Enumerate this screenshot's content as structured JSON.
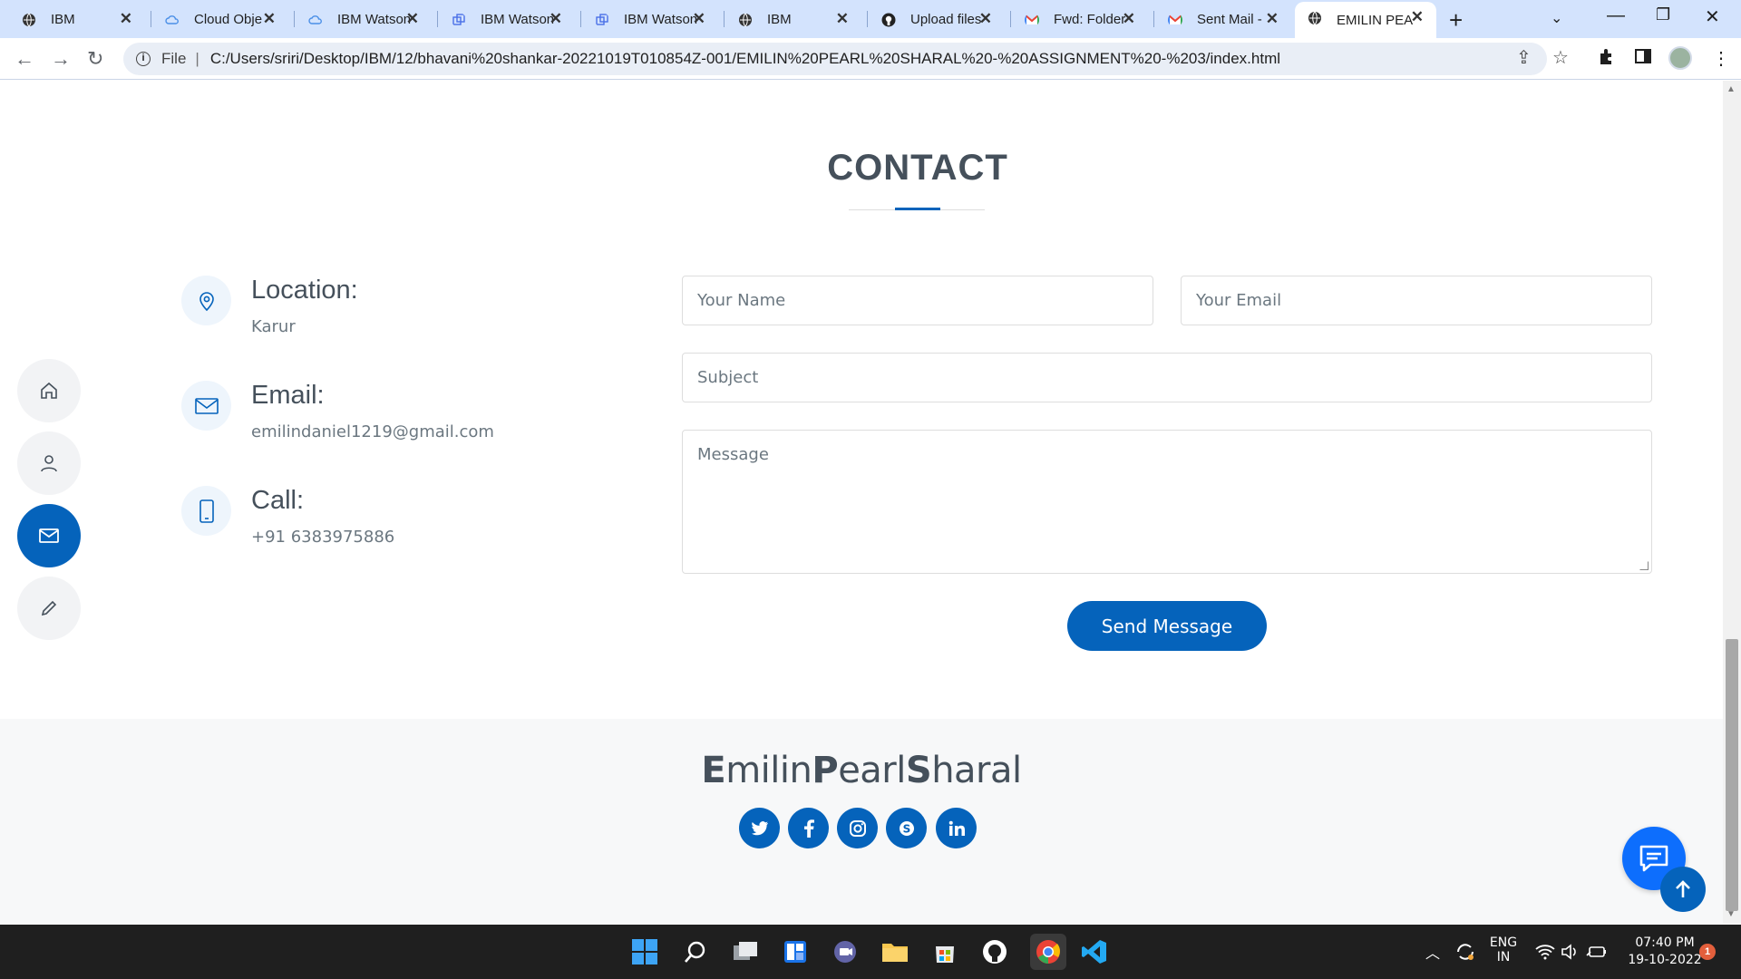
{
  "browser": {
    "tabs": [
      {
        "title": "IBM",
        "favicon": "globe-icon"
      },
      {
        "title": "Cloud Obje",
        "favicon": "cloud-icon"
      },
      {
        "title": "IBM Watson",
        "favicon": "cloud-icon"
      },
      {
        "title": "IBM Watson",
        "favicon": "watson-icon"
      },
      {
        "title": "IBM Watson",
        "favicon": "watson-icon"
      },
      {
        "title": "IBM",
        "favicon": "globe-icon"
      },
      {
        "title": "Upload files",
        "favicon": "github-icon"
      },
      {
        "title": "Fwd: Folder",
        "favicon": "gmail-icon"
      },
      {
        "title": "Sent Mail -",
        "favicon": "gmail-icon"
      },
      {
        "title": "EMILIN PEA",
        "favicon": "globe-icon",
        "active": true
      }
    ],
    "address": {
      "scheme_label": "File",
      "url": "C:/Users/sriri/Desktop/IBM/12/bhavani%20shankar-20221019T010854Z-001/EMILIN%20PEARL%20SHARAL%20-%20ASSIGNMENT%20-%203/index.html"
    }
  },
  "contact": {
    "title": "CONTACT",
    "location": {
      "label": "Location:",
      "value": "Karur"
    },
    "email": {
      "label": "Email:",
      "value": "emilindaniel1219@gmail.com"
    },
    "call": {
      "label": "Call:",
      "value": "+91 6383975886"
    },
    "form": {
      "name_placeholder": "Your Name",
      "email_placeholder": "Your Email",
      "subject_placeholder": "Subject",
      "message_placeholder": "Message",
      "send_label": "Send Message"
    }
  },
  "sidenav": {
    "items": [
      {
        "name": "home-icon"
      },
      {
        "name": "person-icon"
      },
      {
        "name": "envelope-icon",
        "active": true
      },
      {
        "name": "pencil-icon"
      }
    ]
  },
  "footer": {
    "brand_parts": [
      "E",
      "milin",
      "P",
      "earl",
      "S",
      "haral"
    ],
    "social": [
      "twitter-icon",
      "facebook-icon",
      "instagram-icon",
      "skype-icon",
      "linkedin-icon"
    ]
  },
  "taskbar": {
    "lang_line1": "ENG",
    "lang_line2": "IN",
    "time": "07:40 PM",
    "date": "19-10-2022",
    "notification_count": "1"
  },
  "colors": {
    "accent": "#0563bb",
    "heading": "#45505b",
    "tabbar": "#d3e3fd"
  }
}
